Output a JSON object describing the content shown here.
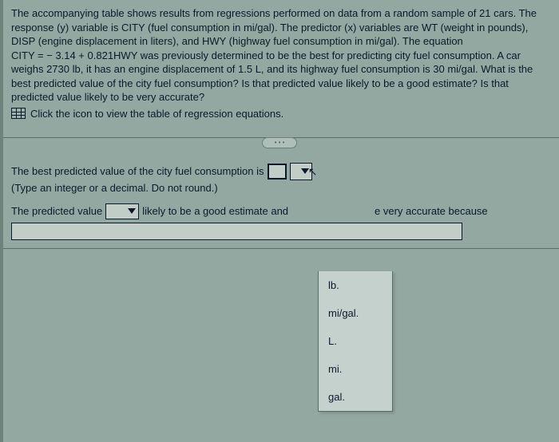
{
  "problem": {
    "p1": "The accompanying table shows results from regressions performed on data from a random sample of 21 cars. The response (y) variable is CITY (fuel consumption in mi/gal). The predictor (x) variables are WT (weight in pounds), DISP (engine displacement in liters), and HWY (highway fuel consumption in mi/gal). The equation",
    "p2": "CITY = − 3.14 + 0.821HWY was previously determined to be the best for predicting city fuel consumption. A car weighs 2730 lb, it has an engine displacement of 1.5 L, and its highway fuel consumption is 30 mi/gal. What is the best predicted value of the city fuel consumption? Is that predicted value likely to be a good estimate? Is that predicted value likely to be very accurate?",
    "link": "Click the icon to view the table of regression equations."
  },
  "q": {
    "line1": "The best predicted value of the city fuel consumption is",
    "hint": "(Type an integer or a decimal. Do not round.)",
    "line2a": "The predicted value",
    "line2b": "likely to be a good estimate and",
    "line2c": "e very accurate because"
  },
  "dropdown": {
    "opt1": "lb.",
    "opt2": "mi/gal.",
    "opt3": "L.",
    "opt4": "mi.",
    "opt5": "gal."
  },
  "pill": "• • •"
}
